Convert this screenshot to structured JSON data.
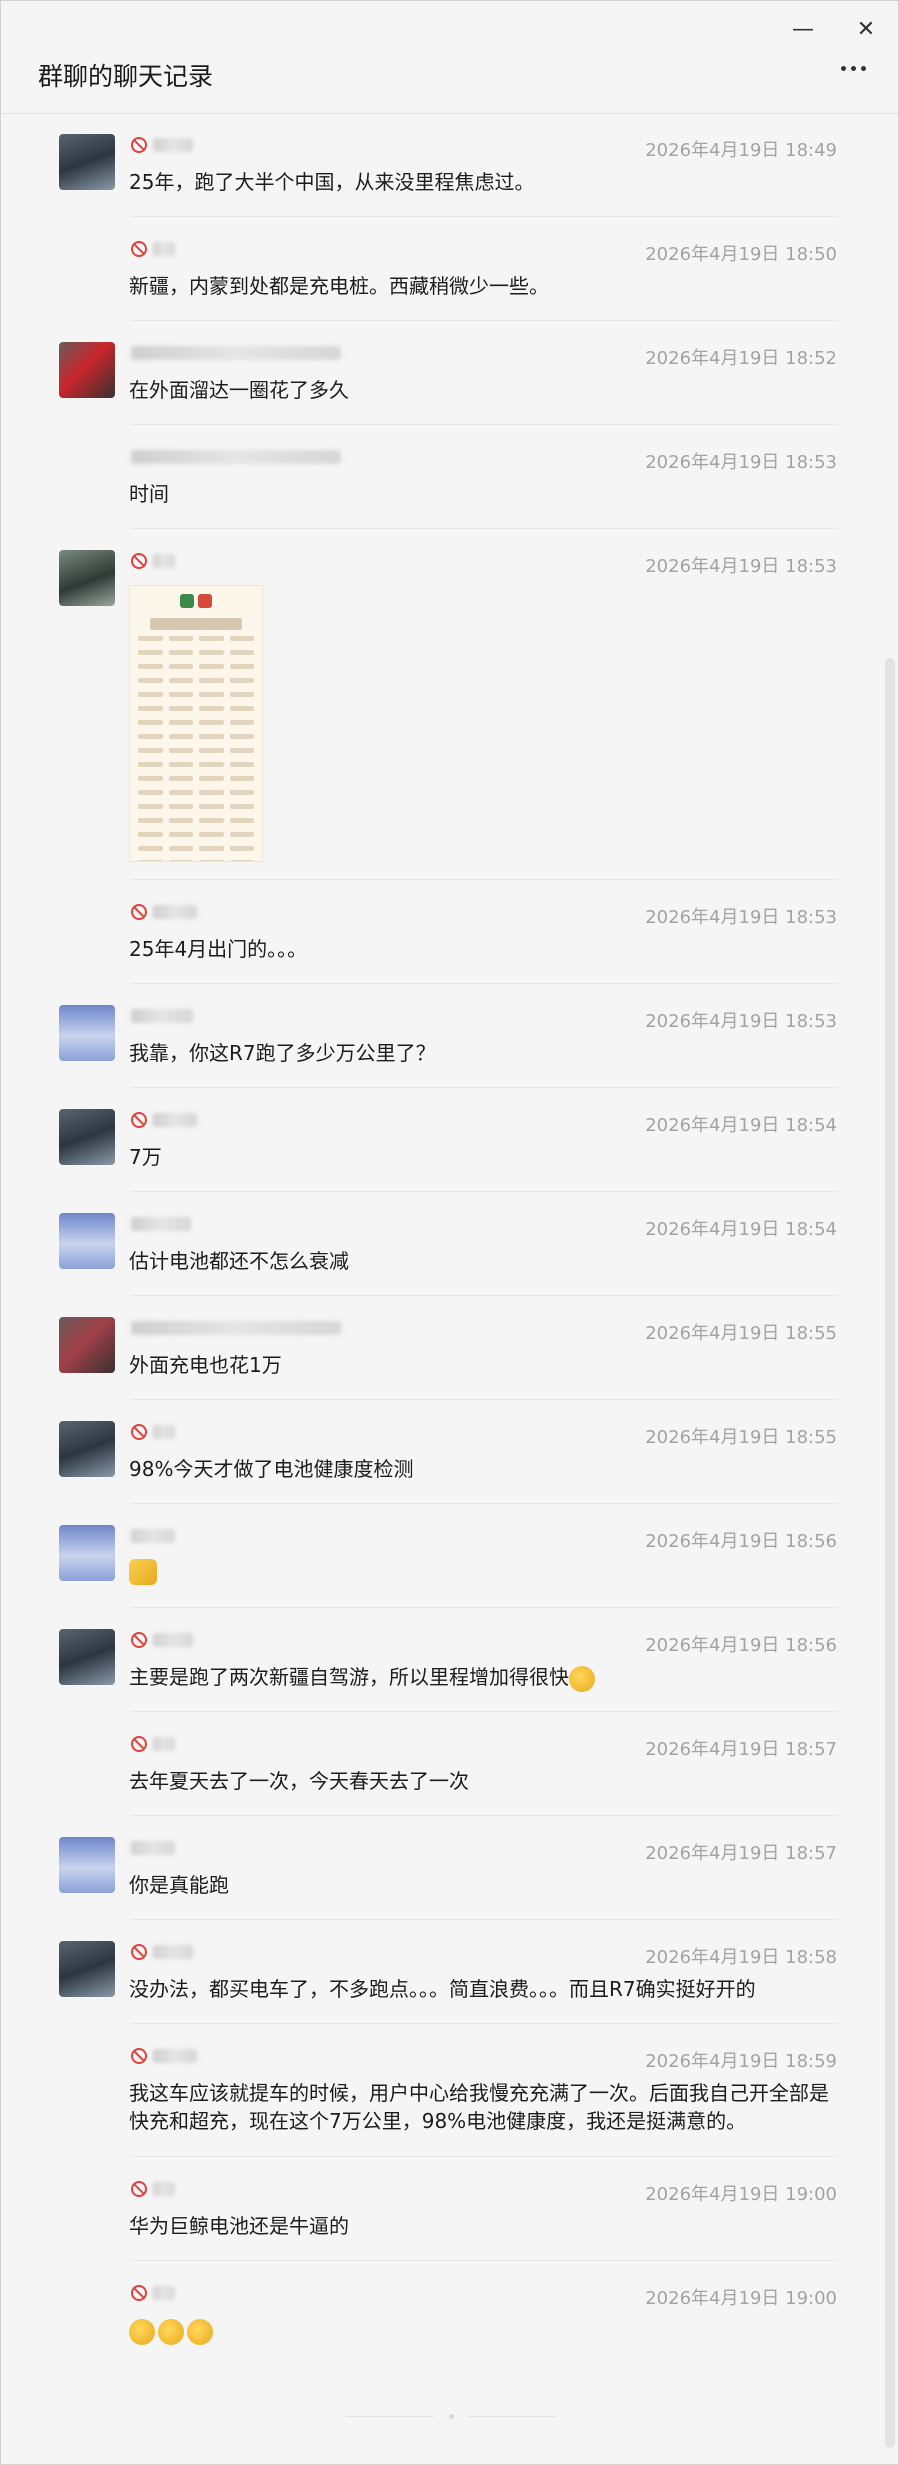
{
  "window": {
    "title": "群聊的聊天记录",
    "minimize_glyph": "—",
    "close_glyph": "✕",
    "more_icon": "more-dots-icon"
  },
  "messages": [
    {
      "time": "2026年4月19日 18:49",
      "text": "25年，跑了大半个中国，从来没里程焦虑过。"
    },
    {
      "time": "2026年4月19日 18:50",
      "text": "新疆，内蒙到处都是充电桩。西藏稍微少一些。"
    },
    {
      "time": "2026年4月19日 18:52",
      "text": "在外面溜达一圈花了多久"
    },
    {
      "time": "2026年4月19日 18:53",
      "text": "时间"
    },
    {
      "time": "2026年4月19日 18:53",
      "text": ""
    },
    {
      "time": "2026年4月19日 18:53",
      "text": "25年4月出门的。。。"
    },
    {
      "time": "2026年4月19日 18:53",
      "text": "我靠，你这R7跑了多少万公里了？"
    },
    {
      "time": "2026年4月19日 18:54",
      "text": "7万"
    },
    {
      "time": "2026年4月19日 18:54",
      "text": "估计电池都还不怎么衰减"
    },
    {
      "time": "2026年4月19日 18:55",
      "text": "外面充电也花1万"
    },
    {
      "time": "2026年4月19日 18:55",
      "text": "98%今天才做了电池健康度检测"
    },
    {
      "time": "2026年4月19日 18:56",
      "text": ""
    },
    {
      "time": "2026年4月19日 18:56",
      "text": "主要是跑了两次新疆自驾游，所以里程增加得很快"
    },
    {
      "time": "2026年4月19日 18:57",
      "text": "去年夏天去了一次，今天春天去了一次"
    },
    {
      "time": "2026年4月19日 18:57",
      "text": "你是真能跑"
    },
    {
      "time": "2026年4月19日 18:58",
      "text": "没办法，都买电车了，不多跑点。。。简直浪费。。。而且R7确实挺好开的"
    },
    {
      "time": "2026年4月19日 18:59",
      "text": "我这车应该就提车的时候，用户中心给我慢充充满了一次。后面我自己开全部是快充和超充，现在这个7万公里，98%电池健康度，我还是挺满意的。"
    },
    {
      "time": "2026年4月19日 19:00",
      "text": "华为巨鲸电池还是牛逼的"
    },
    {
      "time": "2026年4月19日 19:00",
      "text": ""
    }
  ]
}
